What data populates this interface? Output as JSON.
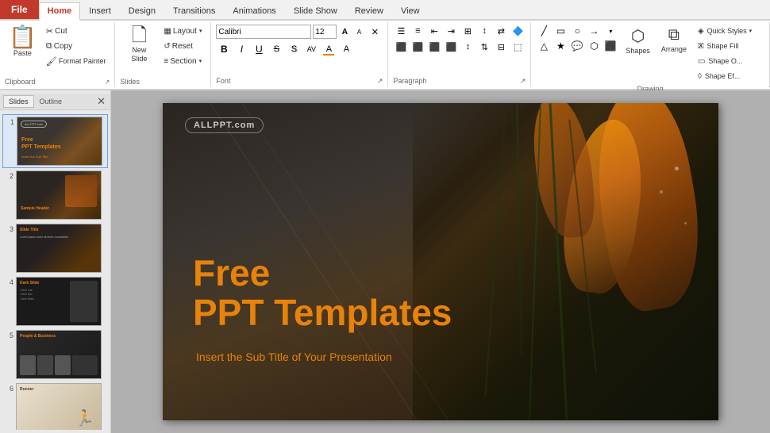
{
  "titleBar": {
    "fileLabel": "File",
    "tabs": [
      "Home",
      "Insert",
      "Design",
      "Transitions",
      "Animations",
      "Slide Show",
      "Review",
      "View"
    ]
  },
  "ribbon": {
    "clipboard": {
      "label": "Clipboard",
      "paste": "Paste",
      "cut": "Cut",
      "copy": "Copy",
      "formatPainter": "Format Painter"
    },
    "slides": {
      "label": "Slides",
      "newSlide": "New\nSlide",
      "layout": "Layout",
      "reset": "Reset",
      "section": "Section"
    },
    "font": {
      "label": "Font",
      "fontName": "Calibri",
      "fontSize": "12",
      "bold": "B",
      "italic": "I",
      "underline": "U",
      "strikethrough": "S",
      "shadowBtn": "S"
    },
    "paragraph": {
      "label": "Paragraph"
    },
    "drawing": {
      "label": "Drawing",
      "shapes": "Shapes",
      "arrange": "Arrange",
      "quickStyles": "Quick\nStyles",
      "shapeOutline": "Shape O...",
      "shapeFill": "Shape F...",
      "shapeEffects": "Shape Ef..."
    }
  },
  "slides": {
    "items": [
      {
        "num": "1",
        "type": "flower-main"
      },
      {
        "num": "2",
        "type": "flower-dark"
      },
      {
        "num": "3",
        "type": "flower-dark2"
      },
      {
        "num": "4",
        "type": "dark-list"
      },
      {
        "num": "5",
        "type": "people"
      },
      {
        "num": "6",
        "type": "runner"
      }
    ]
  },
  "mainSlide": {
    "badge": "ALLPPT.com",
    "titleLine1": "Free",
    "titleLine2": "PPT Templates",
    "subtitle": "Insert the Sub Title of Your Presentation"
  }
}
